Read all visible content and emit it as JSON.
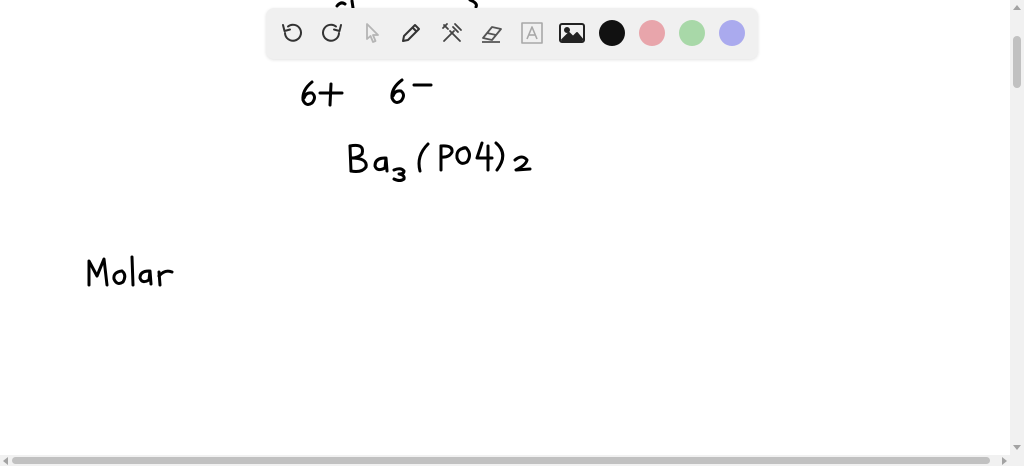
{
  "toolbar": {
    "tools": [
      {
        "icon": "undo-icon",
        "state": "enabled"
      },
      {
        "icon": "redo-icon",
        "state": "enabled"
      },
      {
        "icon": "select-arrow-icon",
        "state": "disabled"
      },
      {
        "icon": "pen-icon",
        "state": "enabled"
      },
      {
        "icon": "tools-icon",
        "state": "enabled"
      },
      {
        "icon": "eraser-icon",
        "state": "enabled"
      },
      {
        "icon": "text-icon",
        "state": "disabled"
      },
      {
        "icon": "image-icon",
        "state": "enabled"
      }
    ],
    "colors": [
      "#111111",
      "#e8a5ab",
      "#a8d8a8",
      "#aaaaee"
    ]
  },
  "handwriting": {
    "charges": [
      "6+",
      "6-"
    ],
    "formula": "Ba3(PO4)2",
    "word": "Molar"
  }
}
